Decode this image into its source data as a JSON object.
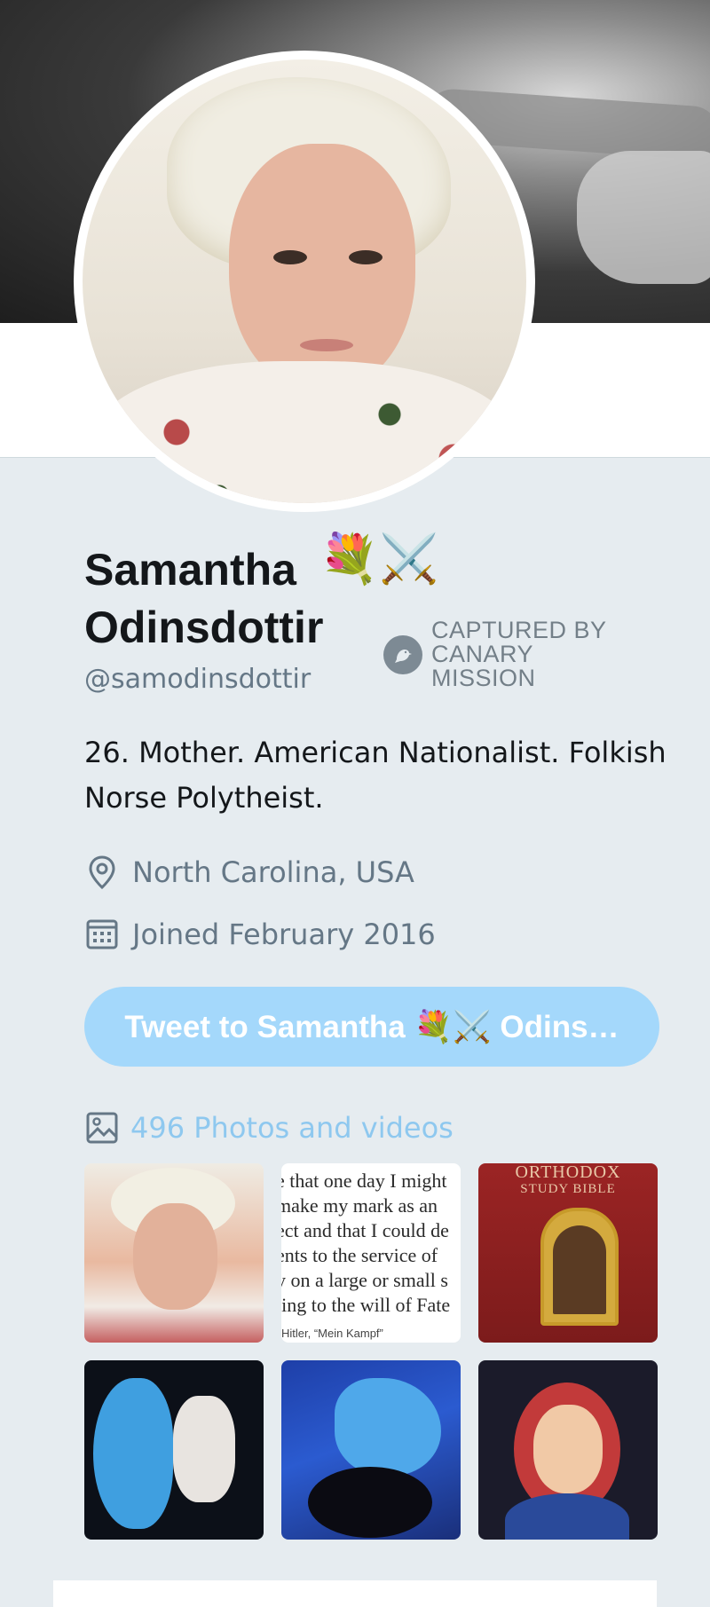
{
  "profile": {
    "display_name_line1": "Samantha",
    "display_name_line2": "Odinsdottir",
    "name_emojis": "💐⚔️",
    "handle": "@samodinsdottir",
    "bio": "26. Mother. American Nationalist. Folkish Norse Polytheist.",
    "location": "North Carolina, USA",
    "joined": "Joined February 2016"
  },
  "badge": {
    "icon": "canary-bird-icon",
    "text": "CAPTURED BY CANARY MISSION"
  },
  "actions": {
    "tweet_to": "Tweet to Samantha 💐⚔️ Odins…"
  },
  "media": {
    "label": "496 Photos and videos",
    "book_quote_lines": [
      "e that one day I might",
      "make my mark as an",
      "ect and that I could de",
      "ents to the service of",
      "y on a large or small s",
      "ling to the will of Fate"
    ],
    "book_quote_source": "Hitler, “Mein Kampf”",
    "book_cover_title_1": "ORTHODOX",
    "book_cover_title_2": "STUDY BIBLE"
  },
  "colors": {
    "background": "#e6ecf0",
    "button_bg": "#a4d8fb",
    "link": "#8ec8ef",
    "secondary_text": "#657786"
  }
}
